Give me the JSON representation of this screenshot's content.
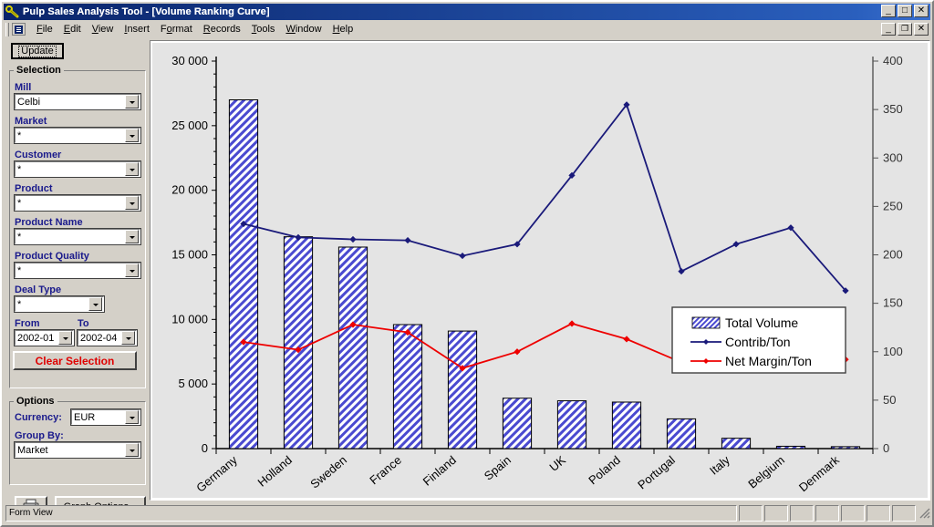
{
  "window": {
    "title": "Pulp Sales Analysis Tool - [Volume Ranking Curve]",
    "app_icon": "wrench-key-icon",
    "controls": {
      "minimize": "_",
      "maximize": "□",
      "close": "✕",
      "mdi_minimize": "_",
      "mdi_restore": "❐",
      "mdi_close": "✕"
    }
  },
  "menubar": {
    "items": [
      {
        "label": "File",
        "accel": "F"
      },
      {
        "label": "Edit",
        "accel": "E"
      },
      {
        "label": "View",
        "accel": "V"
      },
      {
        "label": "Insert",
        "accel": "I"
      },
      {
        "label": "Format",
        "accel": "o"
      },
      {
        "label": "Records",
        "accel": "R"
      },
      {
        "label": "Tools",
        "accel": "T"
      },
      {
        "label": "Window",
        "accel": "W"
      },
      {
        "label": "Help",
        "accel": "H"
      }
    ]
  },
  "sidebar": {
    "update_label": "Update",
    "selection_group": "Selection",
    "fields": [
      {
        "label": "Mill",
        "value": "Celbi"
      },
      {
        "label": "Market",
        "value": "*"
      },
      {
        "label": "Customer",
        "value": "*"
      },
      {
        "label": "Product",
        "value": "*"
      },
      {
        "label": "Product Name",
        "value": "*"
      },
      {
        "label": "Product Quality",
        "value": "*"
      },
      {
        "label": "Deal Type",
        "value": "*"
      }
    ],
    "from_label": "From",
    "to_label": "To",
    "from_value": "2002-01",
    "to_value": "2002-04",
    "clear_label": "Clear Selection",
    "options_group": "Options",
    "currency_label": "Currency:",
    "currency_value": "EUR",
    "groupby_label": "Group By:",
    "groupby_value": "Market",
    "print_icon": "printer-icon",
    "graph_options_label": "Graph Options..."
  },
  "statusbar": {
    "text": "Form View",
    "cells": [
      "",
      "",
      "",
      "",
      "",
      "",
      ""
    ]
  },
  "colors": {
    "bar_fill": "#4a4ad0",
    "bar_edge": "#000000",
    "contrib_line": "#1a1a7a",
    "margin_line": "#ee0000",
    "plot_bg": "#e4e4e4",
    "title_bar": "#0a246a",
    "label_blue": "#1a1a8c",
    "clear_red": "#e00000"
  },
  "chart_data": {
    "type": "bar",
    "title": "Volume Ranking Curve",
    "xlabel": "",
    "ylabel": "",
    "grid": false,
    "legend_position": "center-right",
    "categories": [
      "Germany",
      "Holland",
      "Sweden",
      "France",
      "Finland",
      "Spain",
      "UK",
      "Poland",
      "Portugal",
      "Italy",
      "Belgium",
      "Denmark"
    ],
    "axes": {
      "left": {
        "label": "",
        "min": 0,
        "max": 30000,
        "step": 5000,
        "ticks": [
          "0",
          "5 000",
          "10 000",
          "15 000",
          "20 000",
          "25 000",
          "30 000"
        ],
        "minor_step": 1000
      },
      "right": {
        "label": "",
        "min": 0,
        "max": 400,
        "step": 50,
        "ticks": [
          "0",
          "50",
          "100",
          "150",
          "200",
          "250",
          "300",
          "350",
          "400"
        ]
      }
    },
    "series": [
      {
        "name": "Total Volume",
        "type": "bar",
        "axis": "left",
        "color": "#4a4ad0",
        "pattern": "diagonal-hatch",
        "values": [
          27000,
          16400,
          15600,
          9600,
          9100,
          3900,
          3700,
          3600,
          2300,
          800,
          180,
          150
        ]
      },
      {
        "name": "Contrib/Ton",
        "type": "line",
        "axis": "right",
        "color": "#1a1a7a",
        "marker": "diamond",
        "values": [
          232,
          218,
          216,
          215,
          199,
          211,
          282,
          355,
          183,
          211,
          228,
          163
        ]
      },
      {
        "name": "Net Margin/Ton",
        "type": "line",
        "axis": "right",
        "color": "#ee0000",
        "marker": "diamond",
        "values": [
          110,
          102,
          128,
          120,
          83,
          100,
          129,
          113,
          89,
          85,
          88,
          92
        ]
      }
    ]
  }
}
